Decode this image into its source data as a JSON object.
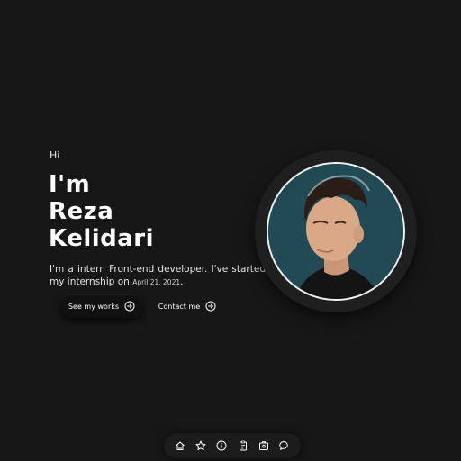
{
  "hero": {
    "greeting": "Hi",
    "name_line1": "I'm",
    "name_line2": "Reza",
    "name_line3": "Kelidari",
    "bio_text": "I'm a intern Front-end developer. I've started my internship on",
    "bio_date": "April 21, 2021",
    "bio_end": ".",
    "works_button_label": "See my works",
    "contact_button_label": "Contact me"
  },
  "icons": {
    "works_arrow": "circle-arrow-right-icon",
    "contact_arrow": "circle-arrow-right-icon"
  },
  "dock": {
    "items": [
      {
        "icon": "home-icon"
      },
      {
        "icon": "star-icon"
      },
      {
        "icon": "info-icon"
      },
      {
        "icon": "clipboard-icon"
      },
      {
        "icon": "portfolio-icon"
      },
      {
        "icon": "chat-icon"
      }
    ]
  },
  "colors": {
    "background": "#171717",
    "avatar_bg": "#214a55",
    "text": "#ffffff"
  }
}
